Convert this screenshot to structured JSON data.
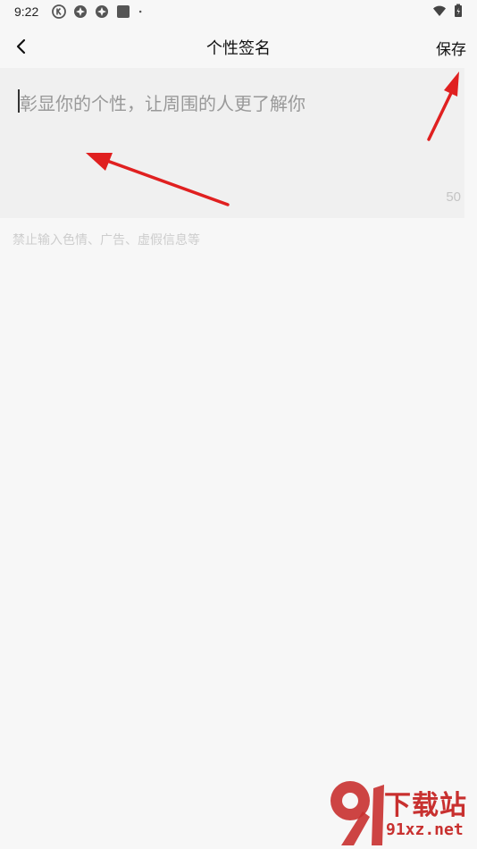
{
  "status_bar": {
    "time": "9:22",
    "left_icons": [
      "k-circle-icon",
      "aperture-icon",
      "aperture-icon",
      "square-icon",
      "dot-icon"
    ],
    "right_icons": [
      "wifi-icon",
      "battery-charging-icon"
    ]
  },
  "header": {
    "back_icon": "chevron-left-icon",
    "title": "个性签名",
    "save_label": "保存"
  },
  "signature_input": {
    "value": "",
    "placeholder": "彰显你的个性，让周围的人更了解你",
    "char_count": "50"
  },
  "hint": "禁止输入色情、广告、虚假信息等",
  "annotations": {
    "arrow_color": "#e02020",
    "arrows": [
      "arrow-to-input",
      "arrow-to-save"
    ]
  },
  "watermark": {
    "logo_text": "91",
    "title": "下载站",
    "url": "91xz.net",
    "color": "#c8302f"
  }
}
